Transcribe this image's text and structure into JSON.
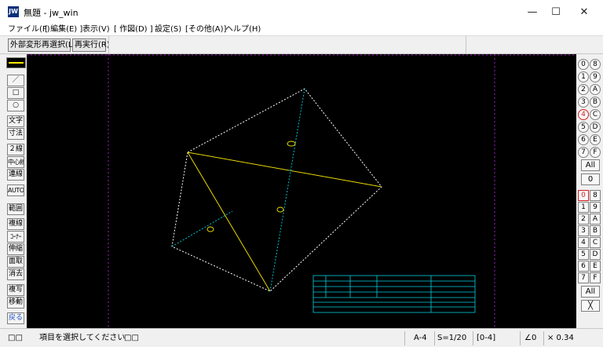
{
  "window": {
    "app_icon": "jw-app-icon",
    "title": "無題 - jw_win",
    "minimize_glyph": "—",
    "maximize_glyph": "☐",
    "close_glyph": "✕"
  },
  "menu": {
    "items": [
      "ファイル(F)",
      "[ 編集(E) ]",
      "表示(V)",
      "[ 作図(D) ]",
      "設定(S)",
      "[その他(A)]",
      "ヘルプ(H)"
    ]
  },
  "toolbar": {
    "reselect_label": "外部変形再選択(L)",
    "rerun_label": "再実行(R)"
  },
  "left_tools": {
    "line": "／",
    "rect": "□",
    "circle": "○",
    "text": "文字",
    "dimension": "寸法",
    "double_line": "２線",
    "center_line": "中心線",
    "continuous_line": "連線",
    "auto": "AUTO",
    "range": "範囲",
    "copy_line": "複線",
    "corner": "ｺｰﾅｰ",
    "stretch": "伸縮",
    "chamfer": "面取",
    "erase": "消去",
    "duplicate": "複写",
    "move": "移動",
    "back": "戻る",
    "line_color_yellow": "#ffe600"
  },
  "right_panel": {
    "layer_groups": [
      [
        "0",
        "8"
      ],
      [
        "1",
        "9"
      ],
      [
        "2",
        "A"
      ],
      [
        "3",
        "B"
      ],
      [
        "4",
        "C"
      ],
      [
        "5",
        "D"
      ],
      [
        "6",
        "E"
      ],
      [
        "7",
        "F"
      ]
    ],
    "active_group": "4",
    "group_all": "All",
    "group_zero": "0",
    "layers": [
      [
        "0",
        "8"
      ],
      [
        "1",
        "9"
      ],
      [
        "2",
        "A"
      ],
      [
        "3",
        "B"
      ],
      [
        "4",
        "C"
      ],
      [
        "5",
        "D"
      ],
      [
        "6",
        "E"
      ],
      [
        "7",
        "F"
      ]
    ],
    "active_layer": "0",
    "layer_all": "All",
    "layer_cross": "╳",
    "active_color": "#d02020"
  },
  "drawing": {
    "line_color": "#ffffff",
    "accent_line_color": "#e8d800",
    "dim_line_color": "#00c0d0",
    "guide_color": "#a020c0",
    "table_color": "#00d0e0"
  },
  "status": {
    "left_icons": "□□",
    "message": "項目を選択してください",
    "mid_icons": "□□",
    "paper": "A-4",
    "scale": "S=1/20",
    "layer_group": "[0-4]",
    "angle": "∠0",
    "zoom": "× 0.34"
  }
}
